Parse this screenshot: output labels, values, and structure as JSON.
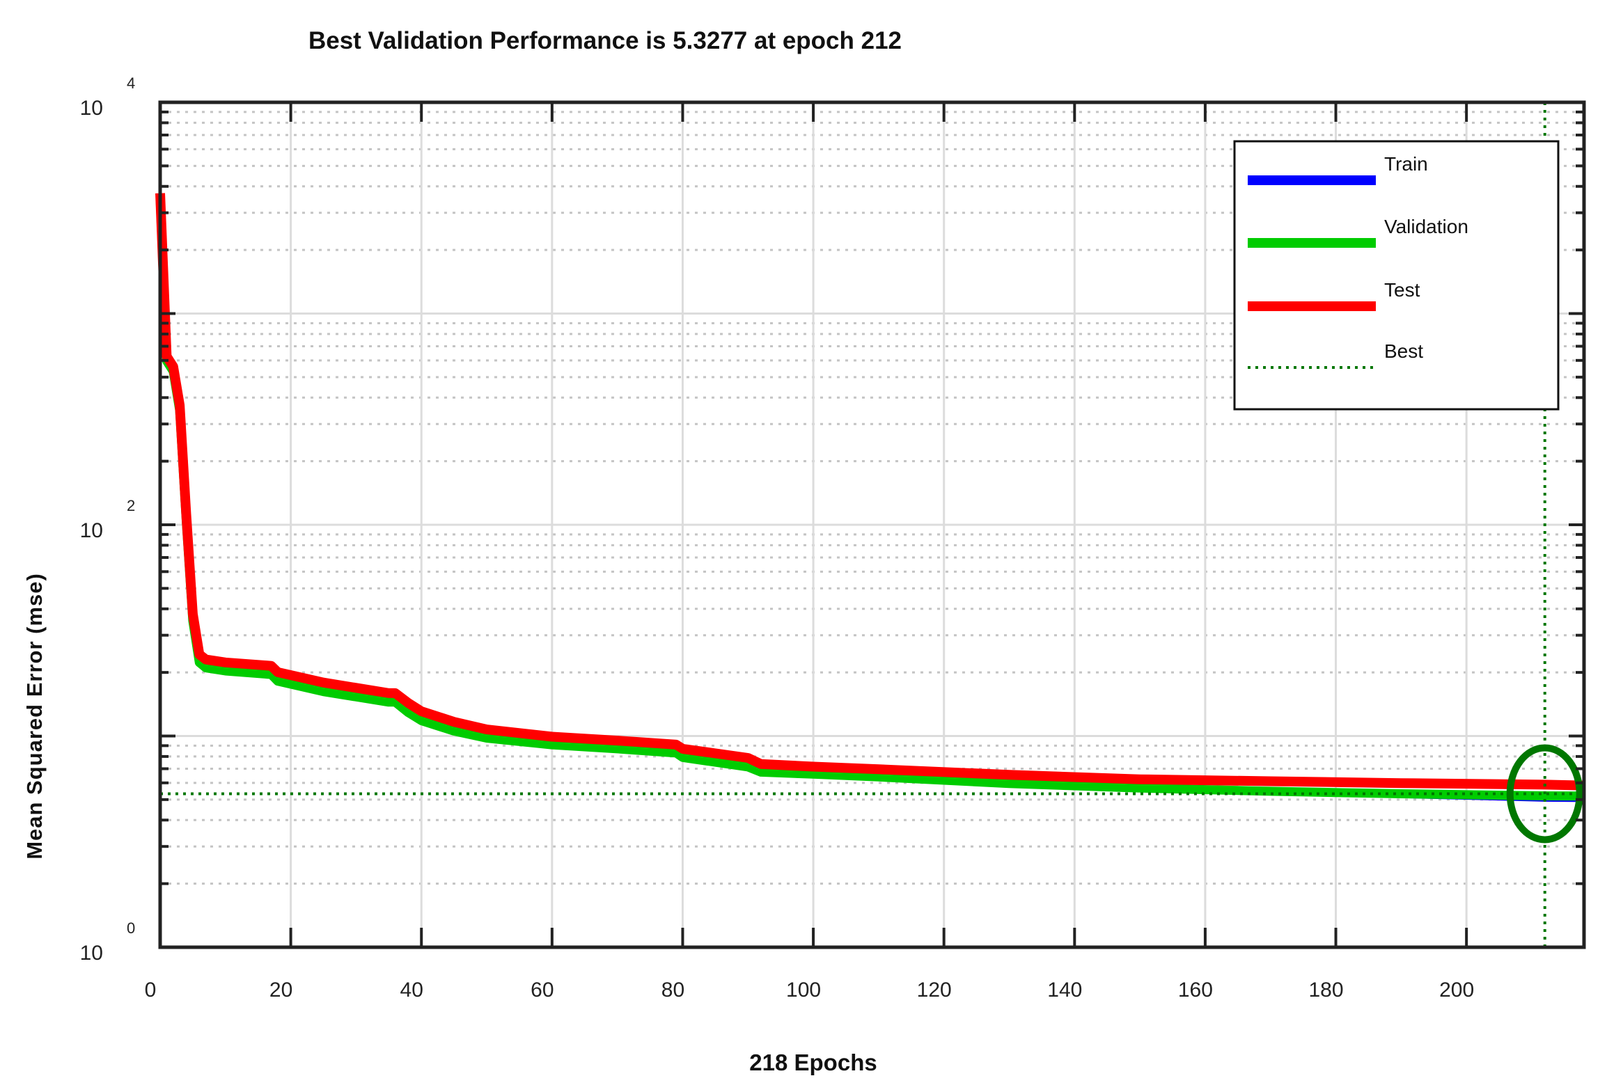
{
  "chart_data": {
    "type": "line",
    "title": "Best Validation Performance is 5.3277 at epoch 212",
    "xlabel": "218 Epochs",
    "ylabel": "Mean Squared Error  (mse)",
    "xlim": [
      0,
      218
    ],
    "ylim": [
      1,
      10000
    ],
    "yscale": "log",
    "grid": true,
    "x_ticks": [
      0,
      20,
      40,
      60,
      80,
      100,
      120,
      140,
      160,
      180,
      200
    ],
    "y_ticks": [
      {
        "base": "10",
        "exp": "0",
        "value": 1
      },
      {
        "base": "10",
        "exp": "2",
        "value": 100
      },
      {
        "base": "10",
        "exp": "4",
        "value": 10000
      }
    ],
    "x": [
      0,
      1,
      2,
      3,
      4,
      5,
      6,
      7,
      10,
      17,
      18,
      25,
      35,
      36,
      38,
      40,
      45,
      50,
      60,
      70,
      79,
      80,
      90,
      92,
      100,
      110,
      130,
      150,
      170,
      190,
      212,
      218
    ],
    "series": [
      {
        "name": "Train",
        "color": "#0000ff",
        "values": [
          3630,
          610,
          545,
          355,
          107,
          36,
          22.8,
          21.5,
          20.8,
          20,
          18.6,
          16.6,
          14.8,
          14.8,
          13.2,
          12.1,
          10.8,
          10.0,
          9.3,
          8.9,
          8.5,
          8.1,
          7.3,
          6.9,
          6.75,
          6.55,
          6.0,
          5.65,
          5.4,
          5.2,
          5.0,
          4.98
        ]
      },
      {
        "name": "Validation",
        "color": "#00cc00",
        "values": [
          3630,
          610,
          545,
          355,
          107,
          36,
          22.8,
          21.5,
          20.8,
          20,
          18.6,
          16.6,
          14.8,
          14.8,
          13.2,
          12.1,
          10.8,
          10.0,
          9.3,
          8.9,
          8.5,
          8.1,
          7.3,
          6.9,
          6.75,
          6.55,
          6.1,
          5.8,
          5.6,
          5.45,
          5.3277,
          5.32
        ]
      },
      {
        "name": "Test",
        "color": "#ff0000",
        "values": [
          3630,
          613,
          548,
          360,
          109,
          37,
          23.8,
          22.5,
          21.8,
          21,
          19.6,
          17.5,
          15.6,
          15.6,
          14,
          12.8,
          11.4,
          10.5,
          9.7,
          9.3,
          8.9,
          8.5,
          7.7,
          7.2,
          7.0,
          6.8,
          6.4,
          6.1,
          5.97,
          5.85,
          5.75,
          5.7
        ]
      }
    ],
    "best": {
      "name": "Best",
      "epoch": 212,
      "value": 5.3277,
      "color": "#007700"
    },
    "legend": {
      "placement": "top-right",
      "entries": [
        "Train",
        "Validation",
        "Test",
        "Best"
      ]
    }
  }
}
